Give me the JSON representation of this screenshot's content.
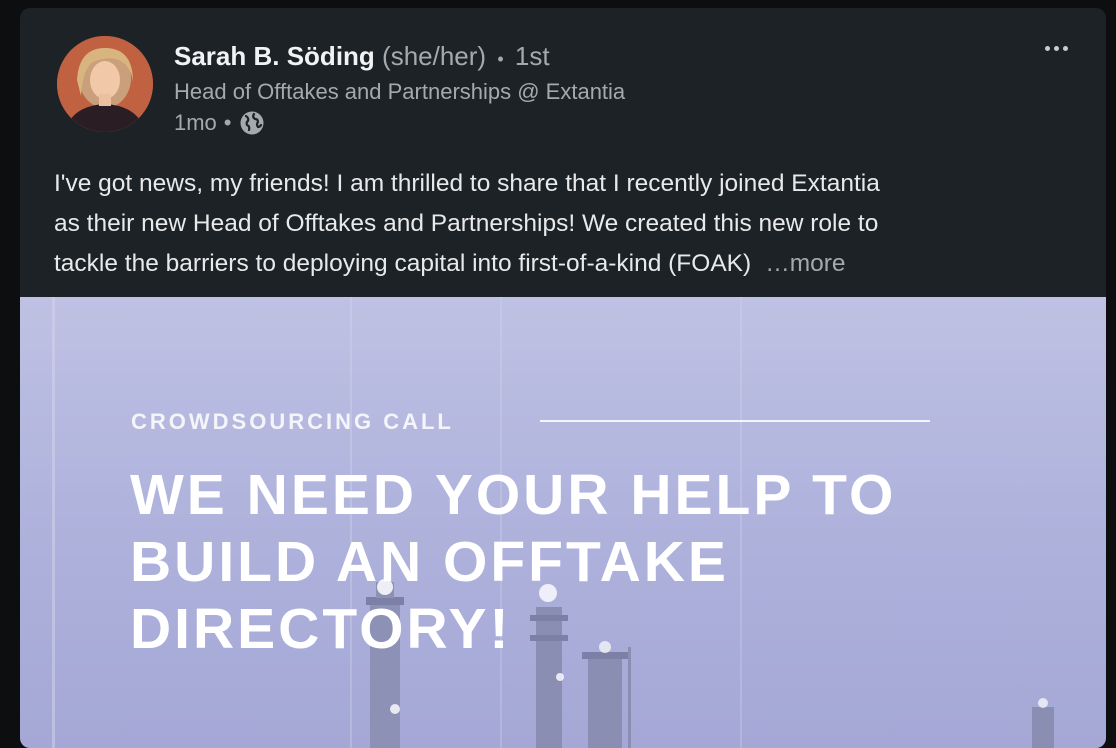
{
  "post": {
    "author": {
      "name": "Sarah B. Söding",
      "pronouns": "(she/her)",
      "separator": "•",
      "degree": "1st",
      "headline": "Head of Offtakes and Partnerships @ Extantia",
      "avatar_icon": "profile-photo"
    },
    "meta": {
      "age": "1mo",
      "separator": "•",
      "visibility_icon": "globe-icon"
    },
    "menu_icon": "more-horizontal-icon",
    "text_lines": [
      "I've got news, my friends! I am thrilled to share that I recently joined Extantia",
      "as their new Head of Offtakes and Partnerships! We created this new role to",
      "tackle the barriers to deploying capital into first-of-a-kind (FOAK)"
    ],
    "see_more": "…more",
    "media": {
      "eyebrow": "CROWDSOURCING CALL",
      "headline_lines": [
        "WE NEED YOUR HELP TO",
        "BUILD AN OFFTAKE",
        "DIRECTORY!"
      ]
    }
  },
  "colors": {
    "card_bg": "#1d2226",
    "page_bg": "#0d0e10",
    "primary_text": "#e8e9ea",
    "secondary_text": "#a6a9ac",
    "media_bg": "#b0b3dc"
  }
}
